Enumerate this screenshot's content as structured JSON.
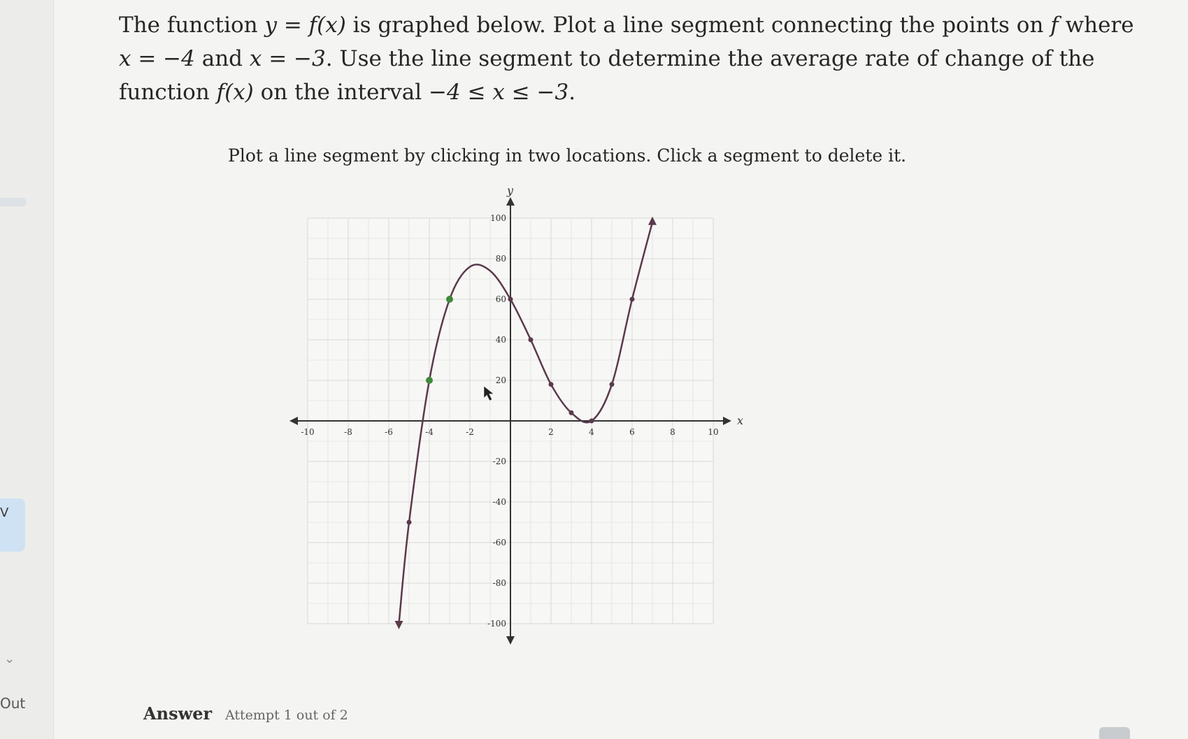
{
  "sidebar": {
    "tab_glyph": "V",
    "chevron_glyph": "⌄",
    "out_label": "Out"
  },
  "question": {
    "part1": "The function ",
    "math1": "y = f(x)",
    "part2": " is graphed below. Plot a line segment connecting the points on ",
    "math2": "f",
    "part3": " where ",
    "math3": "x = −4",
    "part4": " and ",
    "math4": "x = −3",
    "part5": ". Use the line segment to determine the average rate of change of the function ",
    "math5": "f(x)",
    "part6": " on the interval ",
    "math6": "−4 ≤ x ≤ −3",
    "part7": "."
  },
  "instruction": "Plot a line segment by clicking in two locations. Click a segment to delete it.",
  "answer": {
    "label": "Answer",
    "attempt": "Attempt 1 out of 2"
  },
  "colors": {
    "curve": "#5a3a4c",
    "highlight_point": "#3e8a3a",
    "axis": "#333333",
    "grid": "#d9d9d9"
  },
  "chart_data": {
    "type": "line",
    "xlabel": "x",
    "ylabel": "y",
    "xlim": [
      -10,
      10
    ],
    "ylim": [
      -100,
      100
    ],
    "x_ticks": [
      "-10",
      "-8",
      "-6",
      "-4",
      "-2",
      "2",
      "4",
      "6",
      "8",
      "10"
    ],
    "y_ticks": [
      "100",
      "80",
      "60",
      "40",
      "20",
      "-20",
      "-40",
      "-60",
      "-80",
      "-100"
    ],
    "grid": true,
    "series": [
      {
        "points": [
          {
            "x": -5.5,
            "y": -100
          },
          {
            "x": -5,
            "y": -50
          },
          {
            "x": -4,
            "y": 20
          },
          {
            "x": -3,
            "y": 60
          },
          {
            "x": -2,
            "y": 76
          },
          {
            "x": -1,
            "y": 74
          },
          {
            "x": 0,
            "y": 60
          },
          {
            "x": 1,
            "y": 40
          },
          {
            "x": 2,
            "y": 18
          },
          {
            "x": 3,
            "y": 4
          },
          {
            "x": 4,
            "y": 0
          },
          {
            "x": 5,
            "y": 18
          },
          {
            "x": 6,
            "y": 60
          },
          {
            "x": 7,
            "y": 98
          }
        ],
        "marked_points": [
          {
            "x": -5,
            "y": -50
          },
          {
            "x": -4,
            "y": 20
          },
          {
            "x": -3,
            "y": 60
          },
          {
            "x": 0,
            "y": 60
          },
          {
            "x": 1,
            "y": 40
          },
          {
            "x": 2,
            "y": 18
          },
          {
            "x": 3,
            "y": 4
          },
          {
            "x": 4,
            "y": 0
          },
          {
            "x": 5,
            "y": 18
          },
          {
            "x": 6,
            "y": 60
          }
        ],
        "highlighted_points": [
          {
            "x": -4,
            "y": 20
          },
          {
            "x": -3,
            "y": 60
          }
        ]
      }
    ]
  }
}
